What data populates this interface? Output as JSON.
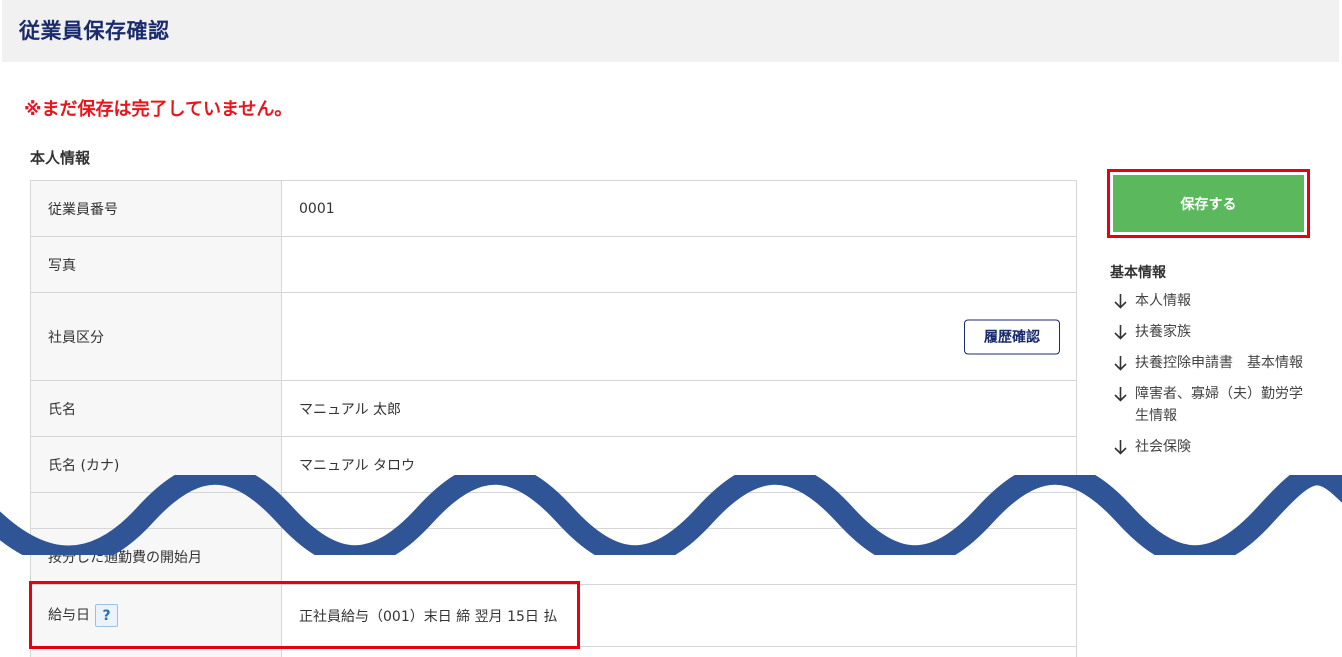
{
  "header": {
    "title": "従業員保存確認"
  },
  "warning": "※まだ保存は完了していません。",
  "section_title": "本人情報",
  "rows": [
    {
      "label": "従業員番号",
      "value": "0001"
    },
    {
      "label": "写真",
      "value": ""
    },
    {
      "label": "社員区分",
      "value": "",
      "button": "履歴確認"
    },
    {
      "label": "氏名",
      "value": "マニュアル 太郎"
    },
    {
      "label": "氏名 (カナ)",
      "value": "マニュアル タロウ"
    },
    {
      "label": "按分した通勤費の開始月",
      "value": ""
    },
    {
      "label": "給与日",
      "value": "正社員給与（001）末日 締 翌月 15日 払",
      "help_icon": "?"
    }
  ],
  "sidebar": {
    "save_label": "保存する",
    "title": "基本情報",
    "items": [
      "本人情報",
      "扶養家族",
      "扶養控除申請書　基本情報",
      "障害者、寡婦（夫）勤労学生情報",
      "社会保険"
    ]
  },
  "colors": {
    "title": "#1a2b6d",
    "warning": "#e8151b",
    "save_button": "#5cb85c",
    "highlight": "#e50012",
    "wave": "#2f5597"
  },
  "icons": [
    "arrow-down-icon",
    "help-icon",
    "wave-divider"
  ]
}
